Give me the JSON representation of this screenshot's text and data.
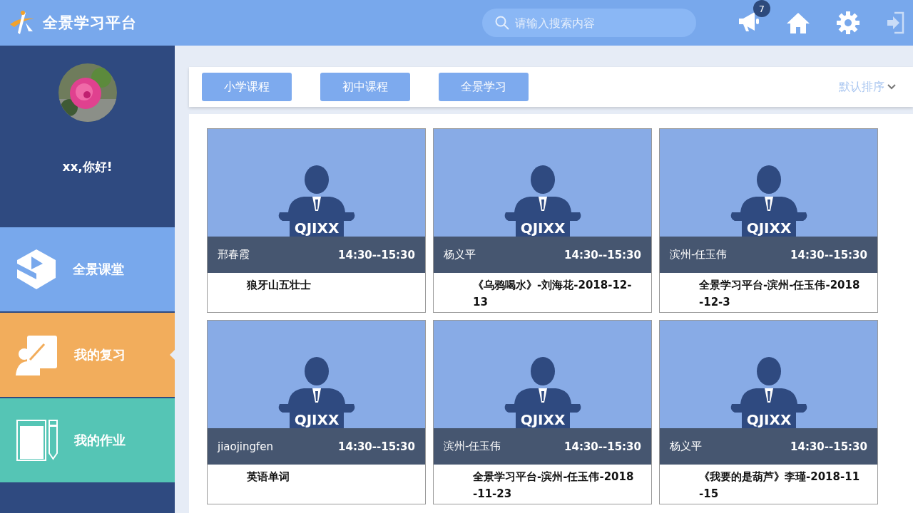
{
  "header": {
    "title": "全景学习平台",
    "search": {
      "placeholder": "请输入搜索内容"
    },
    "notifications": {
      "badge": "7"
    }
  },
  "sidebar": {
    "greeting": "xx,你好!",
    "items": [
      {
        "label": "全景课堂",
        "kind": "classroom",
        "color": "#78a8ec",
        "selected": false
      },
      {
        "label": "我的复习",
        "kind": "review",
        "color": "#f2ad5c",
        "selected": true
      },
      {
        "label": "我的作业",
        "kind": "homework",
        "color": "#55c5b5",
        "selected": false
      }
    ]
  },
  "filters": {
    "tabs": [
      {
        "label": "小学课程"
      },
      {
        "label": "初中课程"
      },
      {
        "label": "全景学习"
      }
    ],
    "sort": "默认排序"
  },
  "courses": [
    {
      "podium_label": "QJIXX",
      "teacher": "邢春霞",
      "time": "14:30--15:30",
      "title": "狼牙山五壮士"
    },
    {
      "podium_label": "QJIXX",
      "teacher": "杨义平",
      "time": "14:30--15:30",
      "title": "《乌鸦喝水》-刘海花-2018-12-13"
    },
    {
      "podium_label": "QJIXX",
      "teacher": "滨州-任玉伟",
      "time": "14:30--15:30",
      "title": "全景学习平台-滨州-任玉伟-2018-12-3"
    },
    {
      "podium_label": "QJIXX",
      "teacher": "jiaojingfen",
      "time": "14:30--15:30",
      "title": "英语单词"
    },
    {
      "podium_label": "QJIXX",
      "teacher": "滨州-任玉伟",
      "time": "14:30--15:30",
      "title": "全景学习平台-滨州-任玉伟-2018-11-23"
    },
    {
      "podium_label": "QJIXX",
      "teacher": "杨义平",
      "time": "14:30--15:30",
      "title": "《我要的是葫芦》李瑾-2018-11-15"
    }
  ]
}
